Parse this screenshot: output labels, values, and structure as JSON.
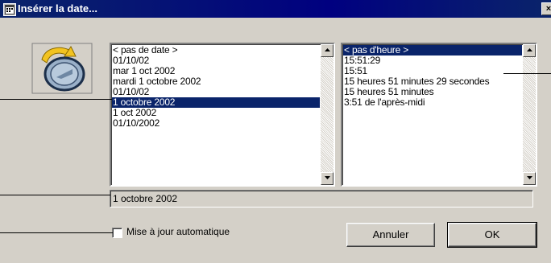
{
  "window": {
    "title": "Insérer la date...",
    "close_glyph": "×"
  },
  "date_list": {
    "items": [
      {
        "label": "< pas de date >",
        "selected": false
      },
      {
        "label": "01/10/02",
        "selected": false
      },
      {
        "label": "mar 1 oct 2002",
        "selected": false
      },
      {
        "label": "mardi 1 octobre 2002",
        "selected": false
      },
      {
        "label": "01/10/02",
        "selected": false
      },
      {
        "label": "1 octobre 2002",
        "selected": true
      },
      {
        "label": "1 oct 2002",
        "selected": false
      },
      {
        "label": "01/10/2002",
        "selected": false
      }
    ]
  },
  "time_list": {
    "items": [
      {
        "label": "< pas d'heure >",
        "selected": true
      },
      {
        "label": "15:51:29",
        "selected": false
      },
      {
        "label": "15:51",
        "selected": false
      },
      {
        "label": "15 heures 51 minutes 29 secondes",
        "selected": false
      },
      {
        "label": "15 heures 51 minutes",
        "selected": false
      },
      {
        "label": "3:51 de l'après-midi",
        "selected": false
      }
    ]
  },
  "preview": {
    "value": "1 octobre 2002"
  },
  "auto_update": {
    "label": "Mise à jour automatique",
    "checked": false
  },
  "buttons": {
    "cancel": "Annuler",
    "ok": "OK"
  },
  "icons": {
    "title": "app-window-icon",
    "app": "calendar-clock-icon",
    "close": "close-icon",
    "scroll_up": "chevron-up-icon",
    "scroll_down": "chevron-down-icon"
  },
  "colors": {
    "titlebar": "#0a246a",
    "selection": "#0a246a",
    "face": "#d4d0c8"
  }
}
